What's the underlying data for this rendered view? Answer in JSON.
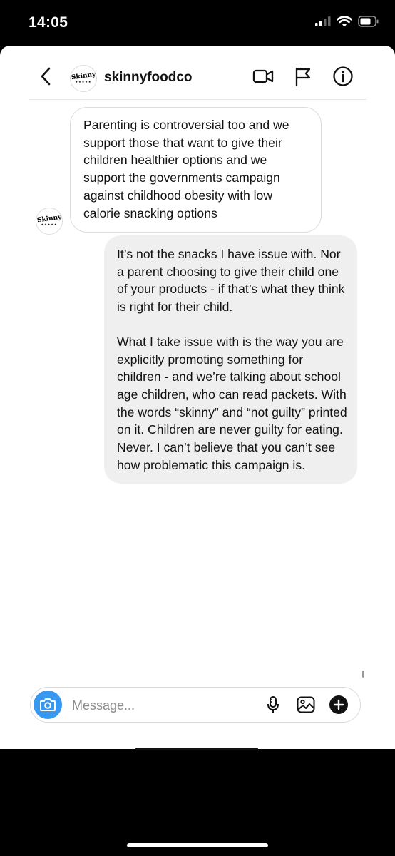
{
  "status_bar": {
    "time": "14:05",
    "icons": [
      "cellular-signal-icon",
      "wifi-icon",
      "battery-icon"
    ]
  },
  "header": {
    "account_name": "skinnyfoodco",
    "avatar": {
      "logo_text": "Skinny",
      "sub_text": "★★★★★"
    },
    "actions": [
      "video-call-icon",
      "report-flag-icon",
      "info-icon"
    ]
  },
  "messages": [
    {
      "sender": "skinnyfoodco",
      "direction": "incoming",
      "paragraphs": [
        "Parenting is controversial too and we support those that want to give their children healthier options and we support the governments campaign against childhood obesity with low calorie snacking options"
      ]
    },
    {
      "sender": "me",
      "direction": "outgoing",
      "paragraphs": [
        "It’s not the snacks I have issue with. Nor a parent choosing to give their child one of your products - if that’s what they think is right for their child.",
        "What I take issue with is the way you are explicitly promoting something for children - and we’re talking about school age children, who can read packets. With the words “skinny” and “not guilty” printed on it. Children are never guilty for eating. Never. I can’t believe that you can’t see how problematic this campaign is."
      ]
    }
  ],
  "composer": {
    "placeholder": "Message...",
    "value": "",
    "actions": [
      "microphone-icon",
      "gallery-icon",
      "add-icon"
    ]
  },
  "colors": {
    "accent": "#3897f0",
    "outgoing_bubble": "#efefef",
    "incoming_border": "#dcdcdc"
  }
}
